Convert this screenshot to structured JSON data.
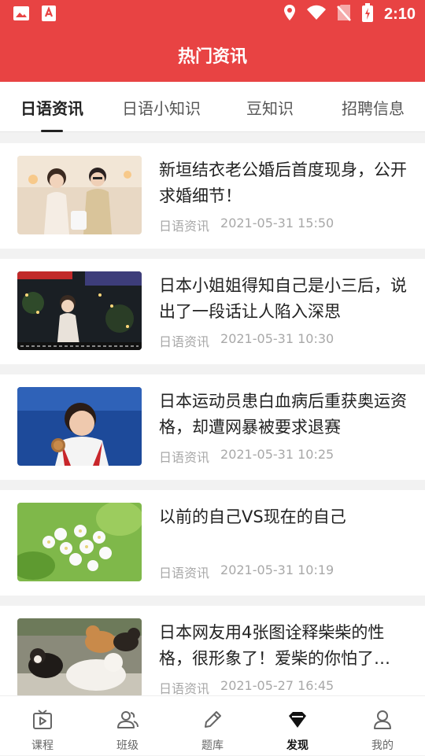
{
  "status_bar": {
    "time": "2:10",
    "icons": [
      "image-icon",
      "app-notification-icon",
      "location-icon",
      "wifi-icon",
      "no-sim-icon",
      "battery-charging-icon"
    ]
  },
  "header": {
    "title": "热门资讯"
  },
  "tabs": [
    {
      "label": "日语资讯",
      "active": true
    },
    {
      "label": "日语小知识",
      "active": false
    },
    {
      "label": "豆知识",
      "active": false
    },
    {
      "label": "招聘信息",
      "active": false
    }
  ],
  "articles": [
    {
      "title": "新垣结衣老公婚后首度现身，公开求婚细节！",
      "category": "日语资讯",
      "datetime": "2021-05-31 15:50",
      "thumb": "couple-photo"
    },
    {
      "title": "日本小姐姐得知自己是小三后，说出了一段话让人陷入深思",
      "category": "日语资讯",
      "datetime": "2021-05-31 10:30",
      "thumb": "tv-show-night"
    },
    {
      "title": "日本运动员患白血病后重获奥运资格，却遭网暴被要求退赛",
      "category": "日语资讯",
      "datetime": "2021-05-31 10:25",
      "thumb": "athlete-medal"
    },
    {
      "title": "以前的自己VS现在的自己",
      "category": "日语资讯",
      "datetime": "2021-05-31 10:19",
      "thumb": "white-blossoms"
    },
    {
      "title": "日本网友用4张图诠释柴柴的性格，很形象了！爱柴的你怕了…",
      "category": "日语资讯",
      "datetime": "2021-05-27 16:45",
      "thumb": "shiba-dogs"
    }
  ],
  "bottom_nav": [
    {
      "label": "课程",
      "icon": "video-lesson-icon",
      "active": false
    },
    {
      "label": "班级",
      "icon": "class-group-icon",
      "active": false
    },
    {
      "label": "题库",
      "icon": "pencil-icon",
      "active": false
    },
    {
      "label": "发现",
      "icon": "diamond-icon",
      "active": true
    },
    {
      "label": "我的",
      "icon": "profile-icon",
      "active": false
    }
  ],
  "colors": {
    "brand_red": "#e84343",
    "active_text": "#222222",
    "meta_text": "#a8a8a8"
  }
}
